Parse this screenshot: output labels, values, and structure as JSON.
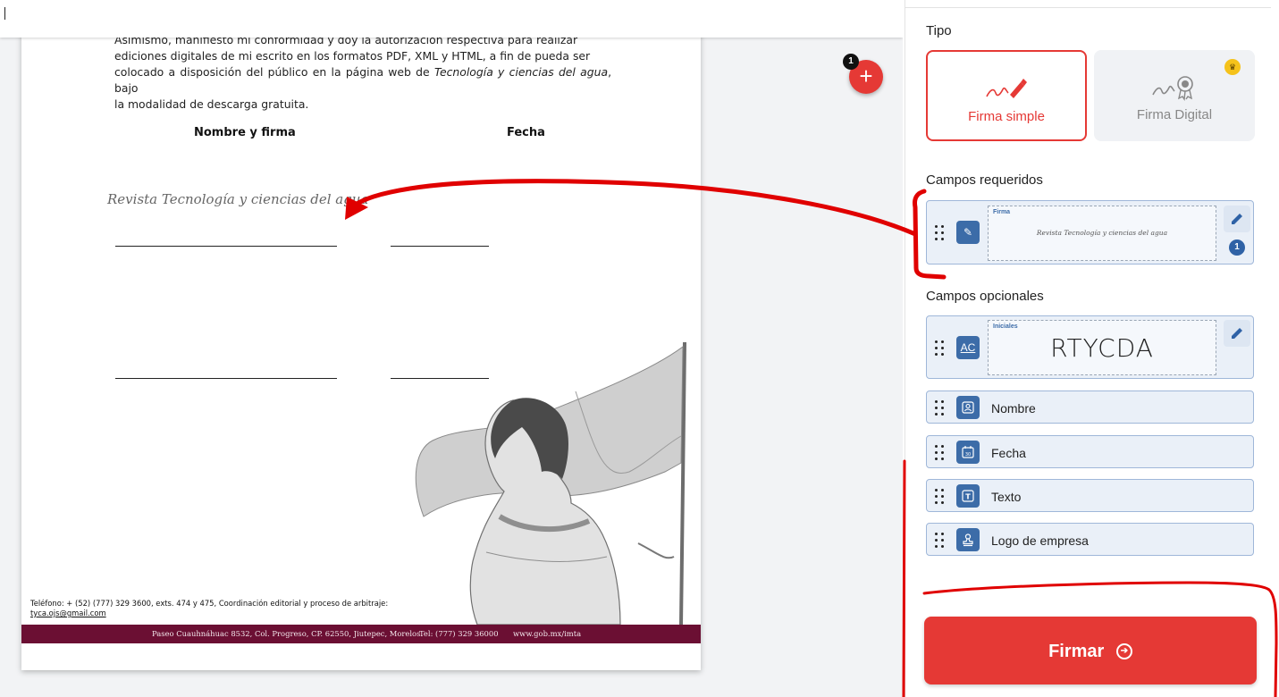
{
  "document": {
    "paragraph_line1": "Asimismo, manifiesto mi conformidad y doy la autorización respectiva para realizar",
    "paragraph_line2": "ediciones digitales de mi escrito en los formatos PDF, XML y HTML, a fin de pueda ser",
    "paragraph_line3_a": "colocado a disposición del público en la página web de ",
    "paragraph_line3_journal": "Tecnología y ciencias del agua",
    "paragraph_line3_b": ", bajo",
    "paragraph_line4": "la modalidad de descarga gratuita.",
    "col_name": "Nombre y firma",
    "col_date": "Fecha",
    "signature_text": "Revista Tecnología y ciencias del agua",
    "footer_contact": "Teléfono: + (52) (777) 329 3600, exts. 474 y 475, Coordinación editorial y proceso de arbitraje:",
    "footer_email": "tyca.ojs@gmail.com",
    "footer_address": "Paseo Cuauhnáhuac 8532, Col. Progreso, CP. 62550, Jiutepec, Morelos.",
    "footer_phone": "Tel: (777) 329 36000",
    "footer_web": "www.gob.mx/imta"
  },
  "fab": {
    "badge": "1",
    "symbol": "+"
  },
  "panel": {
    "tipo_label": "Tipo",
    "type_simple": "Firma simple",
    "type_digital": "Firma Digital",
    "required_label": "Campos requeridos",
    "optional_label": "Campos opcionales",
    "required_fields": [
      {
        "tag": "Firma",
        "preview": "Revista Tecnología y ciencias del agua",
        "count": "1"
      }
    ],
    "optional_fields": [
      {
        "tag": "Iniciales",
        "preview": "RTYCDA",
        "icon_text": "AC"
      },
      {
        "name": "Nombre"
      },
      {
        "name": "Fecha",
        "icon_text": "30"
      },
      {
        "name": "Texto",
        "icon_text": "T"
      },
      {
        "name": "Logo de empresa"
      }
    ],
    "submit_label": "Firmar"
  },
  "colors": {
    "accent": "#e53935",
    "field_blue": "#3c6ca8",
    "footer_maroon": "#6b0f33",
    "annotation": "#e00000"
  }
}
